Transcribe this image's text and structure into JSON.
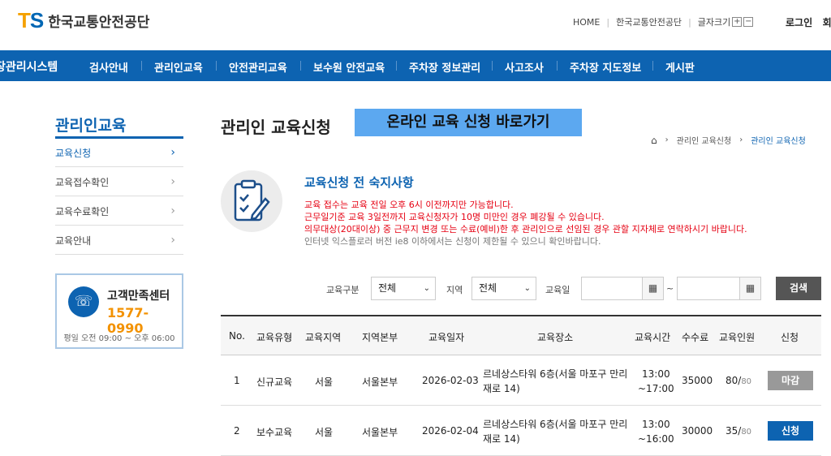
{
  "header": {
    "logo_mark_t": "T",
    "logo_mark_s": "S",
    "logo_text": "한국교통안전공단",
    "util": {
      "home": "HOME",
      "org": "한국교통안전공단",
      "font_size": "글자크기",
      "plus": "+",
      "minus": "−"
    },
    "login": "로그인",
    "login_next": "회"
  },
  "nav": {
    "system_title": "장관리시스템",
    "items": [
      "검사안내",
      "관리인교육",
      "안전관리교육",
      "보수원 안전교육",
      "주차장 정보관리",
      "사고조사",
      "주차장 지도정보",
      "게시판"
    ]
  },
  "sidebar": {
    "title": "관리인교육",
    "items": [
      {
        "label": "교육신청",
        "active": true
      },
      {
        "label": "교육접수확인",
        "active": false
      },
      {
        "label": "교육수료확인",
        "active": false
      },
      {
        "label": "교육안내",
        "active": false
      }
    ],
    "cs": {
      "label": "고객만족센터",
      "phone": "1577-0990",
      "hours": "평일 오전 09:00 ~ 오후 06:00"
    }
  },
  "main": {
    "title": "관리인 교육신청",
    "online_button": "온라인 교육 신청 바로가기",
    "breadcrumb": {
      "level1": "관리인 교육신청",
      "level2": "관리인 교육신청"
    },
    "notice": {
      "title": "교육신청 전 숙지사항",
      "lines": [
        "교육 접수는 교육 전일 오후 6시 이전까지만 가능합니다.",
        "근무일기준 교육 3일전까지 교육신청자가 10명 미만인 경우 폐강될 수 있습니다.",
        "의무대상(20대이상) 중 근무지 변경 또는 수료(예비)한 후 관리인으로 선임된 경우 관할 지자체로 연락하시기 바랍니다.",
        "인터넷 익스플로러 버전 ie8 이하에서는 신청이 제한될 수 있으니 확인바랍니다."
      ]
    },
    "filters": {
      "type_label": "교육구분",
      "type_value": "전체",
      "region_label": "지역",
      "region_value": "전체",
      "date_label": "교육일",
      "tilde": "~",
      "search": "검색"
    },
    "table": {
      "headers": [
        "No.",
        "교육유형",
        "교육지역",
        "지역본부",
        "교육일자",
        "교육장소",
        "교육시간",
        "수수료",
        "교육인원",
        "신청"
      ],
      "rows": [
        {
          "no": "1",
          "type": "신규교육",
          "region": "서울",
          "hq": "서울본부",
          "date": "2026-02-03",
          "place": "르네상스타워 6층(서울 마포구 만리재로 14)",
          "time_start": "13:00",
          "time_end": "~17:00",
          "fee": "35000",
          "count": "80/",
          "cap": "80",
          "action": "마감",
          "status": "closed"
        },
        {
          "no": "2",
          "type": "보수교육",
          "region": "서울",
          "hq": "서울본부",
          "date": "2026-02-04",
          "place": "르네상스타워 6층(서울 마포구 만리재로 14)",
          "time_start": "13:00",
          "time_end": "~16:00",
          "fee": "30000",
          "count": "35/",
          "cap": "80",
          "action": "신청",
          "status": "apply"
        }
      ]
    }
  }
}
